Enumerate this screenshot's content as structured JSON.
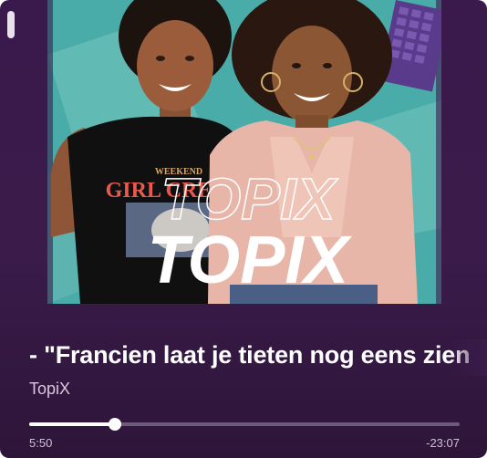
{
  "track": {
    "title": "- \"Francien laat je tieten nog eens zien",
    "artist": "TopiX"
  },
  "artwork": {
    "brand_text": "TOPIX",
    "shirt_text_top": "WEEKEND",
    "shirt_text_main": "GIRL CREW"
  },
  "playback": {
    "elapsed": "5:50",
    "remaining": "-23:07",
    "progress_fraction": 0.2
  },
  "colors": {
    "background": "#3a1b4a",
    "artwork_bg": "#4fb5b0",
    "progress_fill": "#ffffff",
    "progress_track": "#6e5a7a"
  }
}
